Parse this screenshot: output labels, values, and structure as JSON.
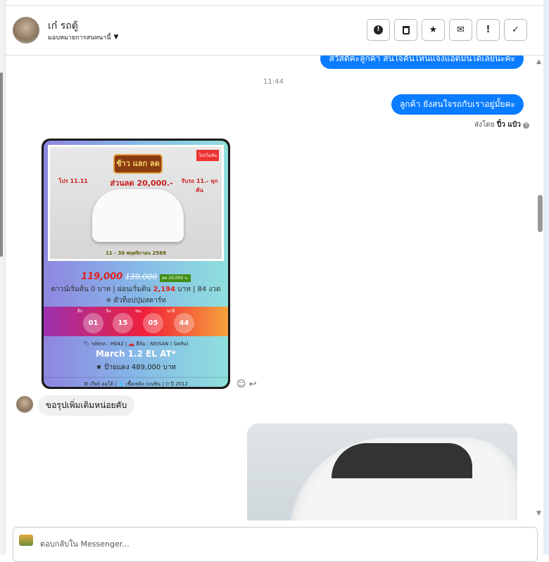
{
  "header": {
    "name": "เก๋ รถตู้",
    "assign_label": "มอบหมายการสนทนานี้",
    "buttons": [
      {
        "icon": "alert-circle-icon",
        "glyph": "⓿"
      },
      {
        "icon": "trash-icon",
        "glyph": "🗑"
      },
      {
        "icon": "star-icon",
        "glyph": "★"
      },
      {
        "icon": "envelope-icon",
        "glyph": "✉"
      },
      {
        "icon": "exclamation-icon",
        "glyph": "!"
      },
      {
        "icon": "check-icon",
        "glyph": "✓"
      }
    ]
  },
  "messages": {
    "out1": "สวัสดีค่ะลูกค้า  สนใจคันไหนแจ้งแอดมินได้เลยนะคะ",
    "time": "11:44",
    "out2": "ลูกค้า ยังสนใจรถกับเราอยู่มั้ยคะ",
    "sent_by_label": "ส่งโดย",
    "sent_by_name": "ปิ๋ว แป๋ว",
    "in1": "ขอรุปเพิ่มเติมหน่อยคับ"
  },
  "card": {
    "promo_title": "ช้าว แลก ลด",
    "promo_badge": "โปรโมชั่น",
    "promo_left": "โปร 11.11",
    "promo_center": "ส่วนลด 20,000.-",
    "promo_right": "รับรถ 11.- ทุกคัน",
    "promo_dates": "11 - 30 พฤศจิกายน 2568",
    "price": "119,000",
    "old_price": "139,000",
    "discount": "ลด 20,000 บ.",
    "finance_a": "ดาวน์เริ่มต้น 0 บาท | ผ่อนเริ่มต้น ",
    "finance_amount": "2,194",
    "finance_b": " บาท | 84 งวด",
    "feature": "✳ ตัวท็อปปุ่มสตาร์ท",
    "countdown": [
      {
        "label": "อีก",
        "value": "01"
      },
      {
        "label": "วัน",
        "value": "15"
      },
      {
        "label": "ชม.",
        "value": "05"
      },
      {
        "label": "นาที",
        "value": "44"
      }
    ],
    "meta": "🏷 รหัสรถ : H042 | 🚗 ยี่ห้อ : NISSAN ( นิสสัน)",
    "model": "March 1.2 EL AT*",
    "plate": "★ ป้ายแดง 489,000 บาท",
    "specs": "⚙ เกียร์ ออโต้   |   💧 เชื้อเพลิง เบนซิน   |   ⏲ ปี 2012"
  },
  "input": {
    "placeholder": "ตอบกลับใน Messenger..."
  }
}
